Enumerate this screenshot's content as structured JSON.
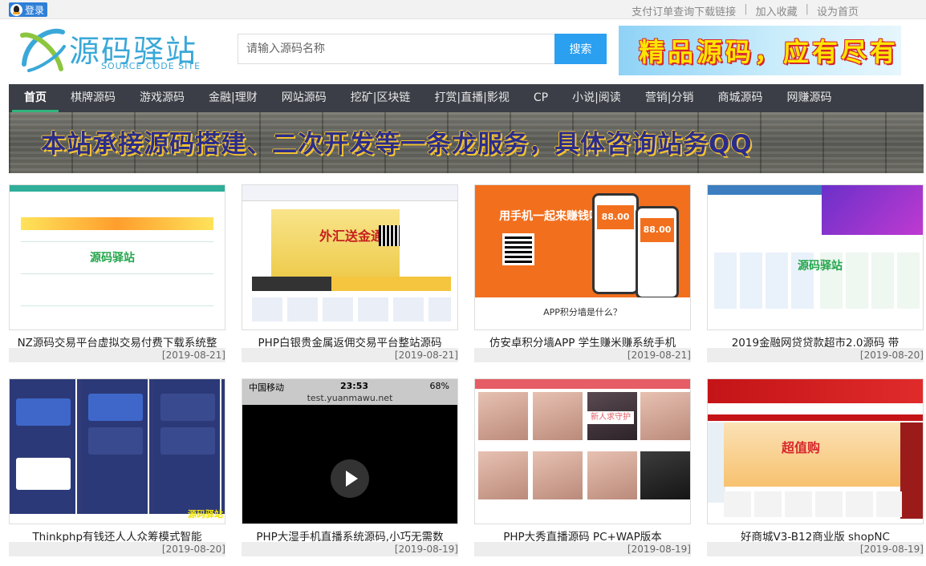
{
  "topbar": {
    "login_label": "登录",
    "links": [
      "支付订单查询下载链接",
      "加入收藏",
      "设为首页"
    ],
    "separator": "|"
  },
  "header": {
    "logo_title": "源码驿站",
    "logo_subtitle": "SOURCE CODE SITE",
    "search_placeholder": "请输入源码名称",
    "search_button": "搜索",
    "ad_text": "精品源码，应有尽有"
  },
  "nav": {
    "items": [
      "首页",
      "棋牌源码",
      "游戏源码",
      "金融|理财",
      "网站源码",
      "挖矿|区块链",
      "打赏|直播|影视",
      "CP",
      "小说|阅读",
      "营销|分销",
      "商城源码",
      "网赚源码"
    ],
    "active_index": 0
  },
  "banner": {
    "text": "本站承接源码搭建、二次开发等一条龙服务，具体咨询站务QQ"
  },
  "cards": [
    {
      "title": "NZ源码交易平台虚拟交易付费下载系统整",
      "date": "[2019-08-21]",
      "thumb_text": "源码驿站"
    },
    {
      "title": "PHP白银贵金属返佣交易平台整站源码",
      "date": "[2019-08-21]",
      "thumb_text": "外汇送金通"
    },
    {
      "title": "仿安卓积分墙APP 学生赚米赚系统手机",
      "date": "[2019-08-21]",
      "thumb_text": "用手机一起来赚钱吧",
      "thumb_sub": "APP积分墙是什么？",
      "thumb_value": "88.00"
    },
    {
      "title": "2019金融网贷贷款超市2.0源码 带",
      "date": "[2019-08-20]",
      "thumb_text": "源码驿站"
    },
    {
      "title": "Thinkphp有钱还人人众筹模式智能",
      "date": "[2019-08-20]",
      "thumb_text": "源码驿站"
    },
    {
      "title": "PHP大湿手机直播系统源码,小巧无需数",
      "date": "[2019-08-19]",
      "thumb_carrier": "中国移动",
      "thumb_time": "23:53",
      "thumb_battery": "68%",
      "thumb_url": "test.yuanmawu.net"
    },
    {
      "title": "PHP大秀直播源码 PC+WAP版本",
      "date": "[2019-08-19]",
      "thumb_text": "新人求守护"
    },
    {
      "title": "好商城V3-B12商业版 shopNC",
      "date": "[2019-08-19]",
      "thumb_text": "超值购"
    }
  ],
  "colors": {
    "nav_bg": "#3b3e46",
    "nav_active_underline": "#2fb57c",
    "search_button": "#2b9ff0",
    "logo_blue": "#3aa8d8"
  }
}
